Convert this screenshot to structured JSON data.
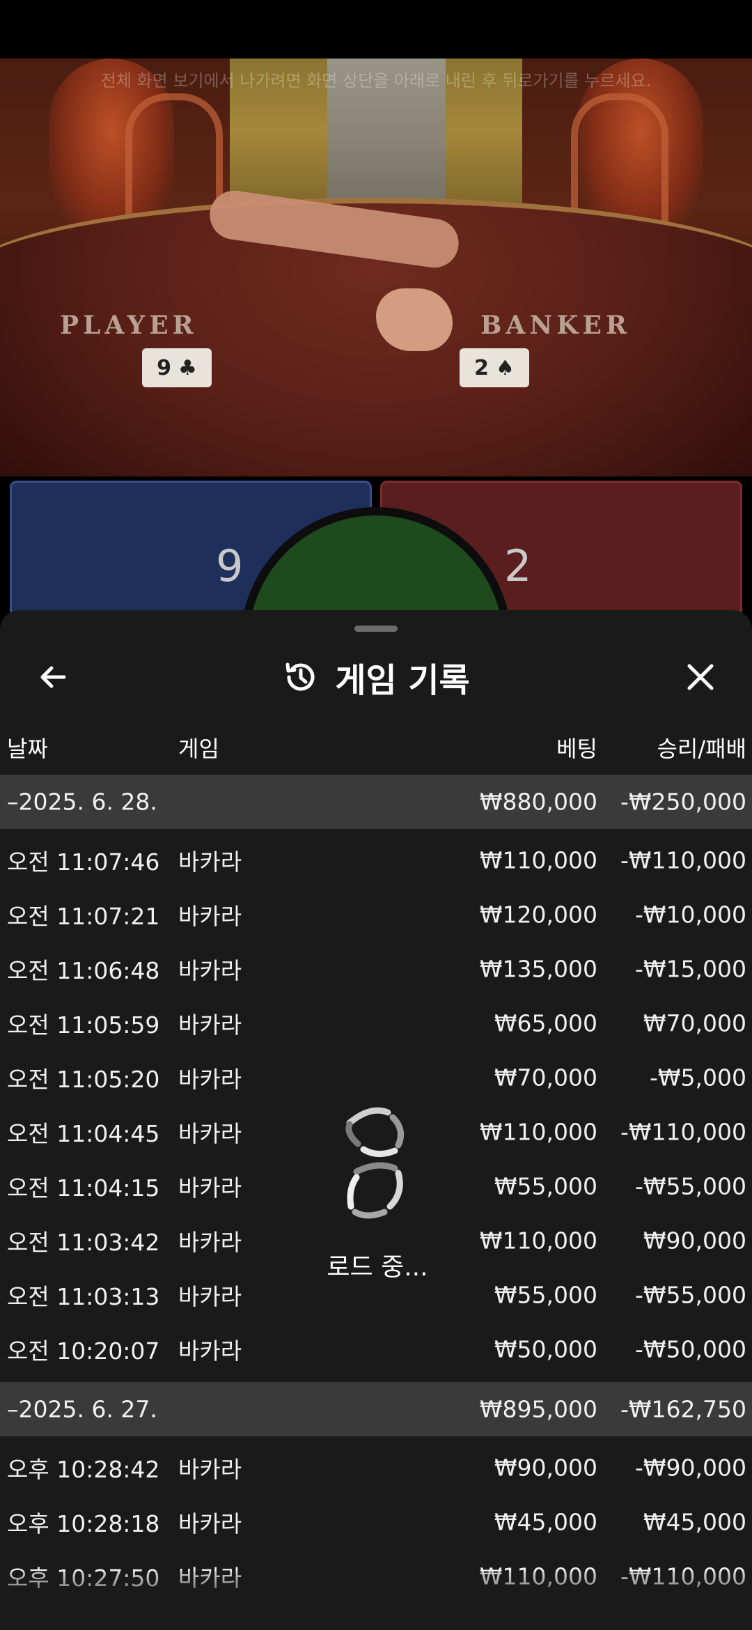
{
  "video": {
    "overlay_message": "전체 화면 보기에서 나가려면 화면 상단을 아래로 내린 후 뒤로가기를 누르세요.",
    "player_label": "PLAYER",
    "banker_label": "BANKER",
    "player_card": "9",
    "banker_card": "2"
  },
  "scores": {
    "player": "9",
    "banker": "2"
  },
  "history": {
    "title": "게임 기록",
    "icons": {
      "back": "back-arrow-icon",
      "history": "history-icon",
      "close": "close-icon",
      "loading": "loading-spinner-icon"
    },
    "columns": {
      "date": "날짜",
      "game": "게임",
      "bet": "베팅",
      "result": "승리/패배"
    },
    "loading_label": "로드 중...",
    "groups": [
      {
        "date": "–2025. 6. 28.",
        "total_bet": "₩880,000",
        "total_result": "-₩250,000",
        "rows": [
          {
            "time": "오전 11:07:46",
            "game": "바카라",
            "bet": "₩110,000",
            "result": "-₩110,000"
          },
          {
            "time": "오전 11:07:21",
            "game": "바카라",
            "bet": "₩120,000",
            "result": "-₩10,000"
          },
          {
            "time": "오전 11:06:48",
            "game": "바카라",
            "bet": "₩135,000",
            "result": "-₩15,000"
          },
          {
            "time": "오전 11:05:59",
            "game": "바카라",
            "bet": "₩65,000",
            "result": "₩70,000"
          },
          {
            "time": "오전 11:05:20",
            "game": "바카라",
            "bet": "₩70,000",
            "result": "-₩5,000"
          },
          {
            "time": "오전 11:04:45",
            "game": "바카라",
            "bet": "₩110,000",
            "result": "-₩110,000"
          },
          {
            "time": "오전 11:04:15",
            "game": "바카라",
            "bet": "₩55,000",
            "result": "-₩55,000"
          },
          {
            "time": "오전 11:03:42",
            "game": "바카라",
            "bet": "₩110,000",
            "result": "₩90,000"
          },
          {
            "time": "오전 11:03:13",
            "game": "바카라",
            "bet": "₩55,000",
            "result": "-₩55,000"
          },
          {
            "time": "오전 10:20:07",
            "game": "바카라",
            "bet": "₩50,000",
            "result": "-₩50,000"
          }
        ]
      },
      {
        "date": "–2025. 6. 27.",
        "total_bet": "₩895,000",
        "total_result": "-₩162,750",
        "rows": [
          {
            "time": "오후 10:28:42",
            "game": "바카라",
            "bet": "₩90,000",
            "result": "-₩90,000"
          },
          {
            "time": "오후 10:28:18",
            "game": "바카라",
            "bet": "₩45,000",
            "result": "₩45,000"
          },
          {
            "time": "오후 10:27:50",
            "game": "바카라",
            "bet": "₩110,000",
            "result": "-₩110,000"
          }
        ]
      }
    ]
  }
}
